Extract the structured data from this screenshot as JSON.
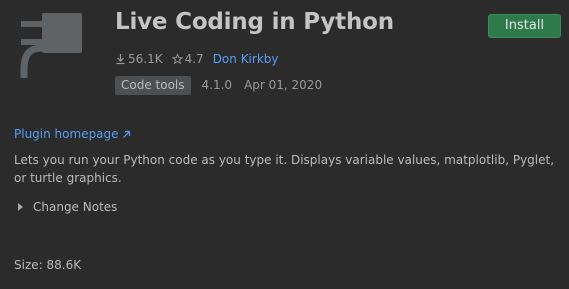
{
  "plugin": {
    "icon": "plug-icon",
    "title": "Live Coding in Python",
    "install_label": "Install",
    "downloads": "56.1K",
    "rating": "4.7",
    "vendor": "Don Kirkby",
    "category": "Code tools",
    "version": "4.1.0",
    "date": "Apr 01, 2020",
    "homepage_label": "Plugin homepage",
    "description": "Lets you run your Python code as you type it. Displays variable values, matplotlib, Pyglet, or turtle graphics.",
    "change_notes_label": "Change Notes",
    "size": "Size: 88.6K"
  },
  "colors": {
    "background": "#2b2b2b",
    "install_button": "#2f7a4a",
    "link": "#589df6",
    "tag_background": "#4c5052"
  }
}
